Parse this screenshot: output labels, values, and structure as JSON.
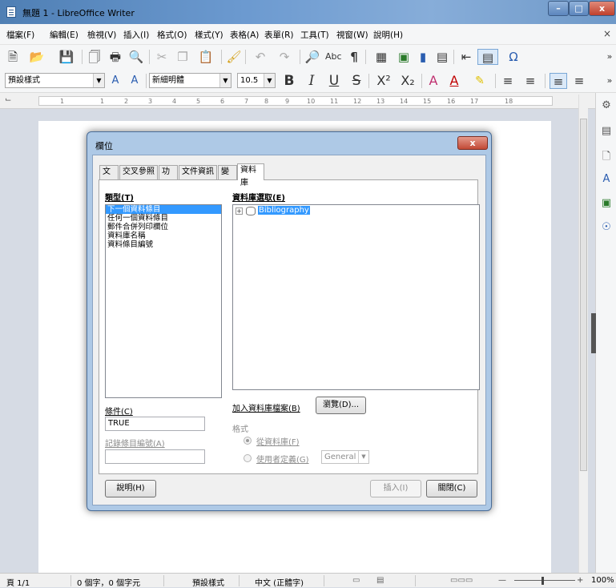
{
  "window": {
    "title": "無題 1 - LibreOffice Writer",
    "minimize": "–",
    "maximize": "□",
    "close": "x"
  },
  "menu": {
    "items": [
      "檔案(F)",
      "編輯(E)",
      "檢視(V)",
      "插入(I)",
      "格式(O)",
      "樣式(Y)",
      "表格(A)",
      "表單(R)",
      "工具(T)",
      "視窗(W)",
      "說明(H)"
    ],
    "close_doc": "×"
  },
  "formatting": {
    "paragraph_style": "預設樣式",
    "font_name": "新細明體",
    "font_size": "10.5"
  },
  "ruler": {
    "numbers": [
      "1",
      "1",
      "2",
      "3",
      "4",
      "5",
      "6",
      "7",
      "8",
      "9",
      "10",
      "11",
      "12",
      "13",
      "14",
      "15",
      "16",
      "17",
      "18"
    ]
  },
  "dialog": {
    "title": "欄位",
    "close": "x",
    "tabs": [
      "文件",
      "交叉參照",
      "功能",
      "文件資訊",
      "變數",
      "資料庫"
    ],
    "active_tab": "資料庫",
    "type_label": "類型(T)",
    "type_items": [
      "下一個資料條目",
      "任何一個資料條目",
      "郵件合併列印欄位",
      "資料庫名稱",
      "資料條目編號"
    ],
    "db_selection_label": "資料庫選取(E)",
    "db_tree_item": "Bibliography",
    "condition_label": "條件(C)",
    "condition_value": "TRUE",
    "record_number_label": "記錄條目編號(A)",
    "record_number_value": "",
    "add_db_file_label": "加入資料庫檔案(B)",
    "browse_button": "瀏覽(D)...",
    "format_label": "格式",
    "from_database_option": "從資料庫(F)",
    "user_defined_option": "使用者定義(G)",
    "user_defined_format": "General",
    "help_button": "說明(H)",
    "insert_button": "插入(I)",
    "close_button": "關閉(C)"
  },
  "status": {
    "page": "頁 1/1",
    "words": "0 個字，0 個字元",
    "page_style": "預設樣式",
    "language": "中文 (正體字)",
    "zoom": "100%"
  }
}
